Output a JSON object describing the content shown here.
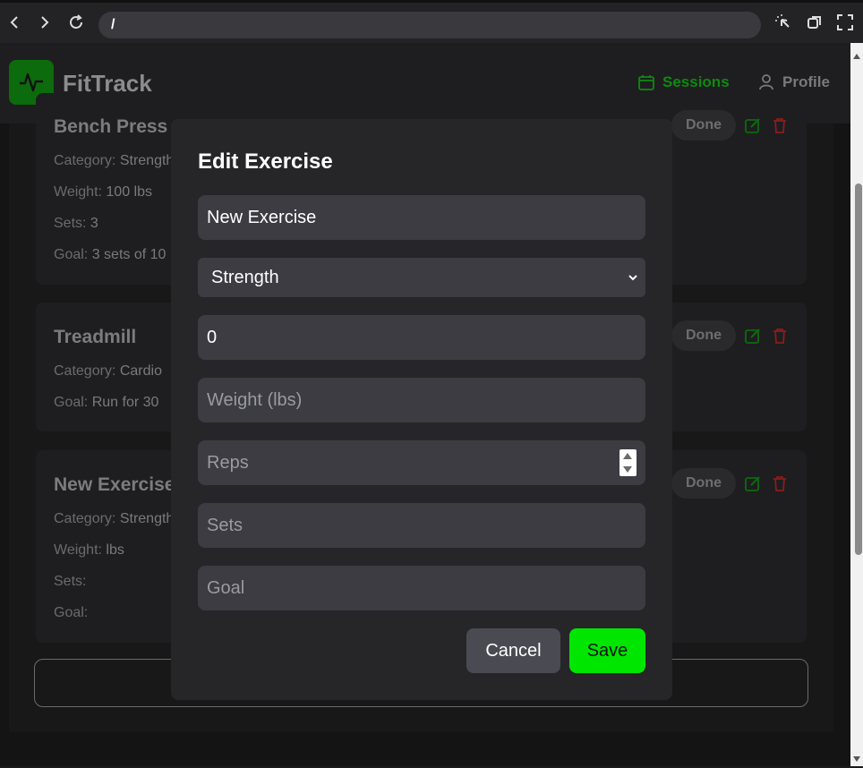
{
  "browser": {
    "url": "/"
  },
  "app": {
    "name": "FitTrack",
    "nav": {
      "sessions": "Sessions",
      "profile": "Profile"
    }
  },
  "cards": [
    {
      "title": "Bench Press",
      "category_label": "Category:",
      "category": "Strength",
      "weight_label": "Weight:",
      "weight": "100 lbs",
      "sets_label": "Sets:",
      "sets": "3",
      "goal_label": "Goal:",
      "goal": "3 sets of 10",
      "done": "Done"
    },
    {
      "title": "Treadmill",
      "category_label": "Category:",
      "category": "Cardio",
      "goal_label": "Goal:",
      "goal": "Run for 30",
      "done": "Done"
    },
    {
      "title": "New Exercise",
      "category_label": "Category:",
      "category": "Strength",
      "weight_label": "Weight:",
      "weight": "lbs",
      "sets_label": "Sets:",
      "sets": "",
      "goal_label": "Goal:",
      "goal": "",
      "done": "Done"
    }
  ],
  "modal": {
    "title": "Edit Exercise",
    "name_value": "New Exercise",
    "category_selected": "Strength",
    "duration_value": "0",
    "weight_placeholder": "Weight (lbs)",
    "reps_placeholder": "Reps",
    "sets_placeholder": "Sets",
    "goal_placeholder": "Goal",
    "cancel_label": "Cancel",
    "save_label": "Save"
  },
  "colors": {
    "accent_green": "#00e600",
    "nav_active": "#0e8a0e",
    "delete_red": "#b22222"
  }
}
